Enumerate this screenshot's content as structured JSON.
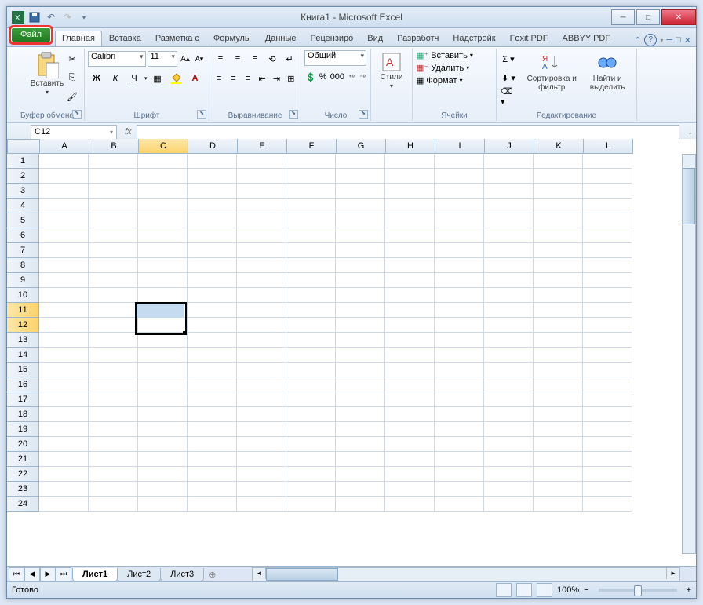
{
  "window": {
    "title": "Книга1 - Microsoft Excel"
  },
  "tabs": {
    "file": "Файл",
    "home": "Главная",
    "insert": "Вставка",
    "layout": "Разметка с",
    "formulas": "Формулы",
    "data": "Данные",
    "review": "Рецензиро",
    "view": "Вид",
    "developer": "Разработч",
    "addins": "Надстройк",
    "foxit": "Foxit PDF",
    "abbyy": "ABBYY PDF"
  },
  "ribbon": {
    "clipboard": {
      "label": "Буфер обмена",
      "paste": "Вставить"
    },
    "font": {
      "label": "Шрифт",
      "name": "Calibri",
      "size": "11"
    },
    "alignment": {
      "label": "Выравнивание"
    },
    "number": {
      "label": "Число",
      "format": "Общий"
    },
    "styles": {
      "label": "",
      "btn": "Стили"
    },
    "cells": {
      "label": "Ячейки",
      "insert": "Вставить",
      "delete": "Удалить",
      "format": "Формат"
    },
    "editing": {
      "label": "Редактирование",
      "sort": "Сортировка и фильтр",
      "find": "Найти и выделить"
    }
  },
  "namebox": "C12",
  "columns": [
    "A",
    "B",
    "C",
    "D",
    "E",
    "F",
    "G",
    "H",
    "I",
    "J",
    "K",
    "L"
  ],
  "rows": [
    1,
    2,
    3,
    4,
    5,
    6,
    7,
    8,
    9,
    10,
    11,
    12,
    13,
    14,
    15,
    16,
    17,
    18,
    19,
    20,
    21,
    22,
    23,
    24
  ],
  "selected_column_index": 2,
  "selected_rows": [
    11,
    12
  ],
  "active_cell": "C12",
  "sheets": {
    "s1": "Лист1",
    "s2": "Лист2",
    "s3": "Лист3"
  },
  "status": {
    "ready": "Готово",
    "zoom": "100%"
  }
}
